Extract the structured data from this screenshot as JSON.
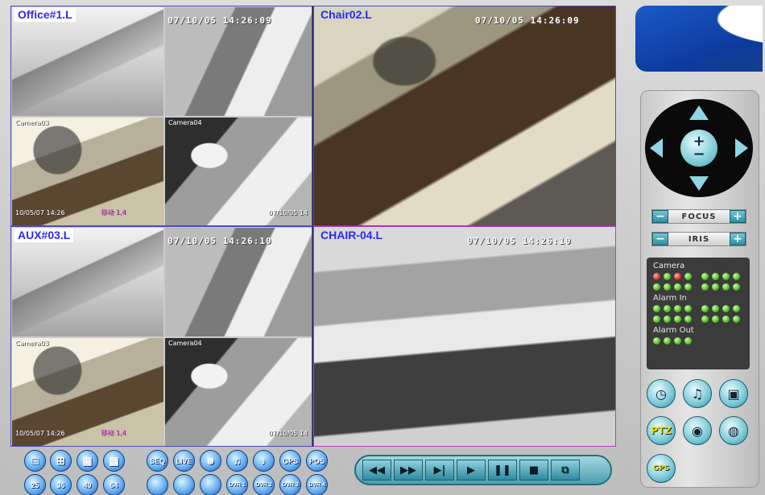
{
  "cameras": {
    "pane1": {
      "title": "Office#1.L",
      "timestamp": "07/10/05  14:26:09",
      "sub_label_3": "Camera03",
      "sub_label_4": "Camera04",
      "sub_ts": "10/05/07 14:26",
      "sub_move": "移动 1,4",
      "sub_move2": "移动",
      "sub_ts_right": "07/10/05 14"
    },
    "pane2": {
      "title": "Chair02.L",
      "timestamp": "07/10/05  14:26:09"
    },
    "pane3": {
      "title": "AUX#03.L",
      "timestamp": "07/10/05  14:26:10",
      "sub_label_3": "Camera03",
      "sub_label_4": "Camera04",
      "sub_ts": "10/05/07 14:26",
      "sub_move": "移动 1,4",
      "sub_ts_right": "07/10/05 14"
    },
    "pane4": {
      "title": "CHAIR-04.L",
      "timestamp": "07/10/05  14:26:10"
    }
  },
  "ptz": {
    "focus_label": "FOCUS",
    "iris_label": "IRIS",
    "minus": "−",
    "plus": "+"
  },
  "status": {
    "camera_label": "Camera",
    "alarm_in_label": "Alarm In",
    "alarm_out_label": "Alarm Out",
    "camera_leds": [
      "red",
      "green",
      "red",
      "green",
      "green",
      "green",
      "green",
      "green",
      "green",
      "green",
      "green",
      "green",
      "green",
      "green",
      "green",
      "green"
    ],
    "alarm_in_leds": 16,
    "alarm_out_leds": 4
  },
  "side_buttons": {
    "ptz_label": "PTZ",
    "gps_label": "GPS"
  },
  "bottom": {
    "row1_text": [
      "SEQ",
      "LIVE",
      "",
      "",
      "",
      "GPS",
      "POS"
    ],
    "row2_layouts": [
      "25",
      "36",
      "49",
      "64"
    ],
    "dvr_labels": [
      "DVR 1",
      "DVR 2",
      "DVR 3",
      "DVR 4"
    ]
  },
  "transport": {
    "rewind": "◀◀",
    "forward": "▶▶",
    "step": "▶|",
    "play": "▶",
    "pause": "❚❚",
    "stop": "■",
    "copy": "⧉"
  }
}
